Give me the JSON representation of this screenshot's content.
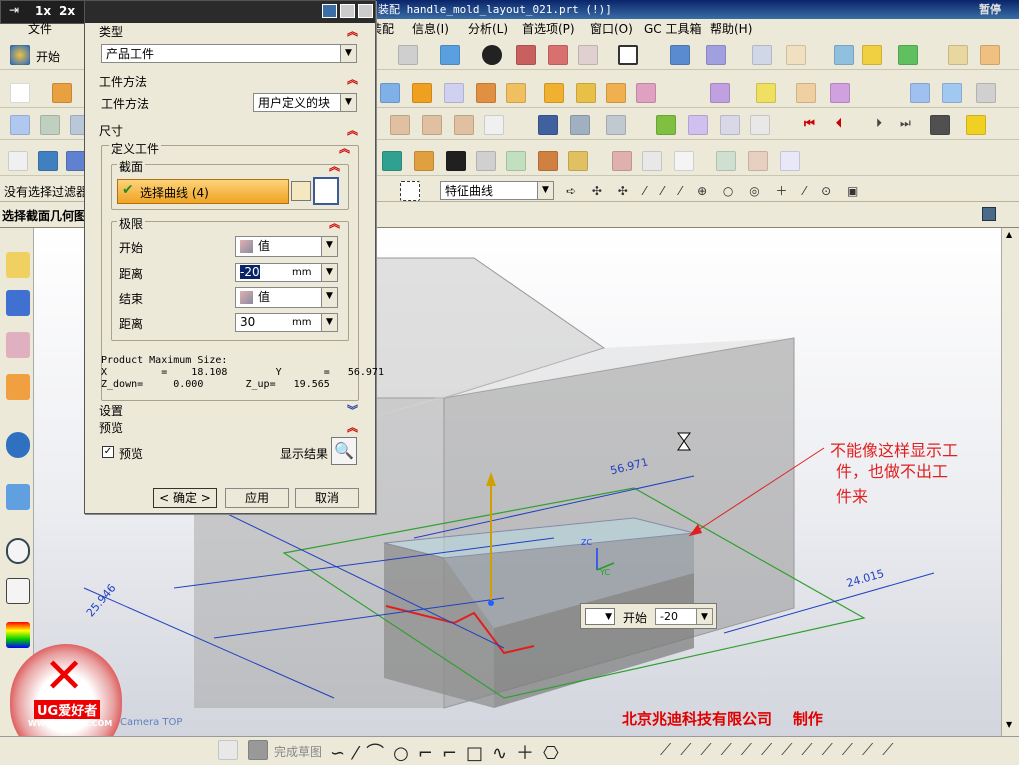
{
  "app": {
    "window_title": "装配 handle_mold_layout_021.prt   (!)]",
    "logo_text": "暂停"
  },
  "menu": [
    "装配",
    "信息(I)",
    "分析(L)",
    "首选项(P)",
    "窗口(O)",
    "GC 工具箱",
    "帮助(H)"
  ],
  "left_menu": {
    "file": "文件",
    "start": "开始"
  },
  "float_toolbar": [
    "1x",
    "2x",
    "3D"
  ],
  "filter": {
    "label": "没有选择过滤器",
    "curve_rule": "特征曲线"
  },
  "status": {
    "prompt": "选择截面几何图"
  },
  "dialog": {
    "type_header": "类型",
    "type_value": "产品工件",
    "method_header": "工件方法",
    "method_label": "工件方法",
    "method_value": "用户定义的块",
    "size_header": "尺寸",
    "define_header": "定义工件",
    "section_header": "截面",
    "select_curve": "选择曲线 (4)",
    "limits_header": "极限",
    "start_label": "开始",
    "start_option": "值",
    "dist1_label": "距离",
    "dist1_value": "-20",
    "dist1_unit": "mm",
    "end_label": "结束",
    "end_option": "值",
    "dist2_label": "距离",
    "dist2_value": "30",
    "dist2_unit": "mm",
    "max_size_title": "Product Maximum Size:",
    "max_x": "X         =    18.108        Y       =   56.971",
    "max_z": "Z_down=     0.000       Z_up=   19.565",
    "settings_header": "设置",
    "preview_header": "预览",
    "preview_check": "预览",
    "show_result": "显示结果",
    "ok": "< 确定 >",
    "apply": "应用",
    "cancel": "取消"
  },
  "viewport": {
    "annotation": [
      "不能像这样显示工",
      "件，也做不出工",
      "件来"
    ],
    "dim_top": "56.971",
    "dim_right": "24.015",
    "dim_left": "25.946",
    "axis_zc": "ZC",
    "axis_yc": "YC",
    "onscreen_label": "开始",
    "onscreen_value": "-20",
    "camera": "Camera TOP",
    "company": "北京兆迪科技有限公司    制作",
    "watermark_url": "WWW.UGSNX.COM",
    "watermark_brand": "UG爱好者"
  },
  "bottom": {
    "finish_sketch": "完成草图"
  },
  "colors": {
    "accent_red": "#cc0000",
    "sel_orange": "#f8b432",
    "title_blue": "#0a246a"
  }
}
